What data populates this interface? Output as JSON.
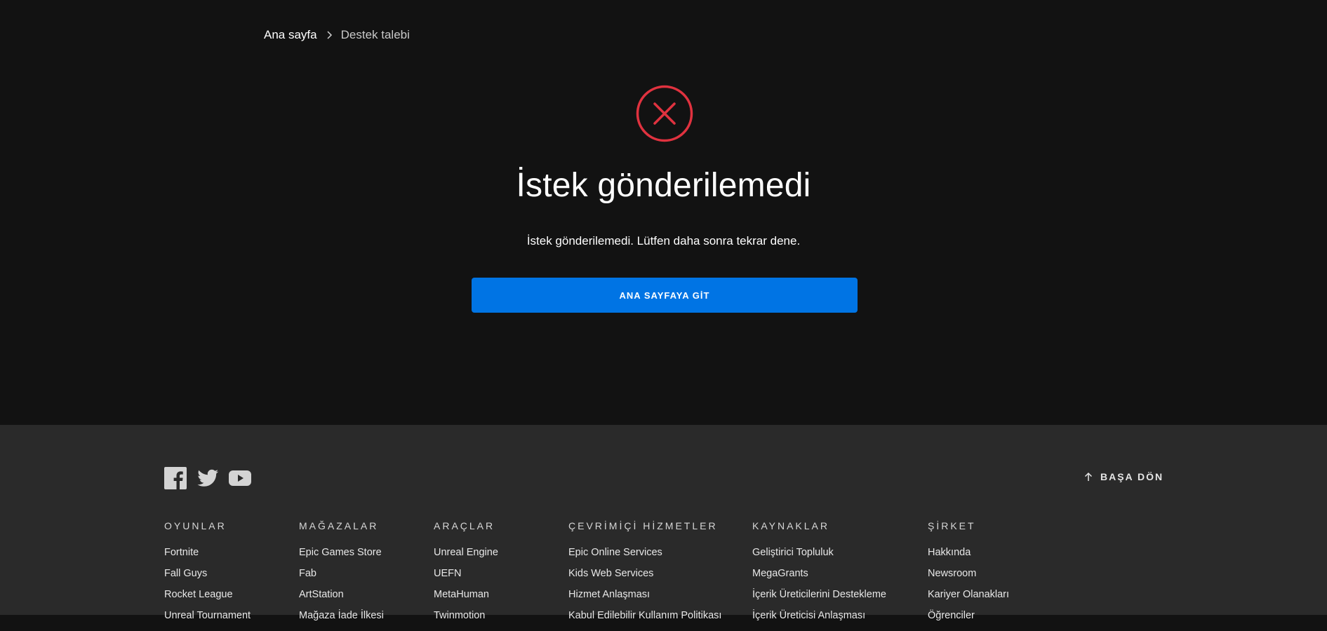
{
  "breadcrumb": {
    "home": "Ana sayfa",
    "current": "Destek talebi"
  },
  "error": {
    "icon": "x-circle-icon",
    "color": "#e0323f",
    "title": "İstek gönderilemedi",
    "message": "İstek gönderilemedi. Lütfen daha sonra tekrar dene.",
    "button_label": "ANA SAYFAYA GİT",
    "button_color": "#0074e4"
  },
  "footer": {
    "social": [
      "facebook-icon",
      "twitter-icon",
      "youtube-icon"
    ],
    "back_to_top": "BAŞA DÖN",
    "columns": [
      {
        "title": "OYUNLAR",
        "items": [
          "Fortnite",
          "Fall Guys",
          "Rocket League",
          "Unreal Tournament"
        ]
      },
      {
        "title": "MAĞAZALAR",
        "items": [
          "Epic Games Store",
          "Fab",
          "ArtStation",
          "Mağaza İade İlkesi"
        ]
      },
      {
        "title": "ARAÇLAR",
        "items": [
          "Unreal Engine",
          "UEFN",
          "MetaHuman",
          "Twinmotion"
        ]
      },
      {
        "title": "ÇEVRİMİÇİ HİZMETLER",
        "items": [
          "Epic Online Services",
          "Kids Web Services",
          "Hizmet Anlaşması",
          "Kabul Edilebilir Kullanım Politikası"
        ]
      },
      {
        "title": "KAYNAKLAR",
        "items": [
          "Geliştirici Topluluk",
          "MegaGrants",
          "İçerik Üreticilerini Destekleme",
          "İçerik Üreticisi Anlaşması"
        ]
      },
      {
        "title": "ŞİRKET",
        "items": [
          "Hakkında",
          "Newsroom",
          "Kariyer Olanakları",
          "Öğrenciler"
        ]
      }
    ]
  }
}
